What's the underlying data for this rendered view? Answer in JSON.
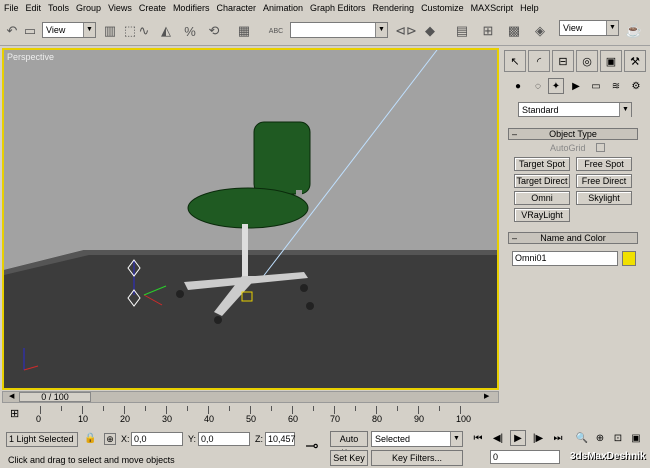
{
  "menu": [
    "File",
    "Edit",
    "Tools",
    "Group",
    "Views",
    "Create",
    "Modifiers",
    "Character",
    "Animation",
    "Graph Editors",
    "Rendering",
    "Customize",
    "MAXScript",
    "Help"
  ],
  "toolbar": {
    "ref_coord": "View",
    "ref_coord2": "View",
    "named_sel": "",
    "abc_label": "ABC"
  },
  "viewport": {
    "label": "Perspective"
  },
  "command_panel": {
    "category": "Standard",
    "object_type": {
      "title": "Object Type",
      "autogrid": "AutoGrid",
      "buttons": [
        "Target Spot",
        "Free Spot",
        "Target Direct",
        "Free Direct",
        "Omni",
        "Skylight",
        "VRayLight"
      ]
    },
    "name_color": {
      "title": "Name and Color",
      "name": "Omni01",
      "color": "#f0e000"
    }
  },
  "timeline": {
    "position": "0 / 100",
    "current_frame": 0,
    "total_frames": 100,
    "ticks": [
      "0",
      "10",
      "20",
      "30",
      "40",
      "50",
      "60",
      "70",
      "80",
      "90",
      "100"
    ]
  },
  "status": {
    "selection": "1 Light Selected",
    "x_label": "X:",
    "x": "0,0",
    "y_label": "Y:",
    "y": "0,0",
    "z_label": "Z:",
    "z": "10,457",
    "prompt": "Click and drag to select and move objects",
    "auto_key": "Auto Key",
    "set_key": "Set Key",
    "selected": "Selected",
    "key_filters": "Key Filters...",
    "frame": "0"
  },
  "watermark": "3dsMaxDeshnik",
  "colors": {
    "viewport_border": "#e8d000",
    "chair": "#1f5a22",
    "floor": "#3c3c3c",
    "light_line": "#bfe0ff"
  }
}
